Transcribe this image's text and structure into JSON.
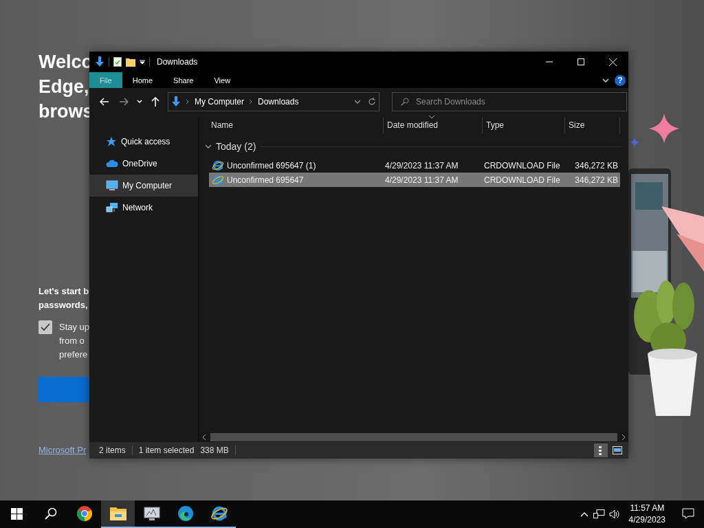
{
  "background_page": {
    "heading_lines": [
      "Welco",
      "Edge,",
      "brows"
    ],
    "intro_lines": [
      "Let's start b",
      "passwords,"
    ],
    "checkbox": {
      "checked": true,
      "lines": [
        "Stay up",
        "from o",
        "prefere"
      ]
    },
    "link": "Microsoft Pr"
  },
  "window": {
    "title": "Downloads",
    "ribbon_tabs": [
      {
        "label": "File",
        "selected": true
      },
      {
        "label": "Home",
        "selected": false
      },
      {
        "label": "Share",
        "selected": false
      },
      {
        "label": "View",
        "selected": false
      }
    ],
    "help": "?",
    "address": {
      "path": [
        "My Computer",
        "Downloads"
      ]
    },
    "search": {
      "placeholder": "Search Downloads"
    },
    "nav_pane": [
      {
        "label": "Quick access",
        "kind": "star",
        "selected": false
      },
      {
        "label": "OneDrive",
        "kind": "cloud",
        "selected": false
      },
      {
        "label": "My Computer",
        "kind": "computer",
        "selected": true
      },
      {
        "label": "Network",
        "kind": "network",
        "selected": false
      }
    ],
    "columns": [
      "Name",
      "Date modified",
      "Type",
      "Size"
    ],
    "groups": [
      {
        "label": "Today (2)",
        "expanded": true,
        "rows": [
          {
            "name": "Unconfirmed 695647 (1)",
            "date": "4/29/2023 11:37 AM",
            "type": "CRDOWNLOAD File",
            "size": "346,272 KB",
            "selected": false
          },
          {
            "name": "Unconfirmed 695647",
            "date": "4/29/2023 11:37 AM",
            "type": "CRDOWNLOAD File",
            "size": "346,272 KB",
            "selected": true
          }
        ]
      }
    ],
    "status_bar": {
      "item_count": "2 items",
      "selection": "1 item selected",
      "selection_size": "338 MB"
    },
    "views": [
      {
        "kind": "details",
        "selected": true
      },
      {
        "kind": "large-icons",
        "selected": false
      }
    ]
  },
  "taskbar": {
    "apps": [
      {
        "kind": "chrome",
        "running": false,
        "selected": false
      },
      {
        "kind": "folder",
        "running": true,
        "selected": true
      },
      {
        "kind": "monitor",
        "running": true,
        "selected": false
      },
      {
        "kind": "edge",
        "running": true,
        "selected": false
      },
      {
        "kind": "ie",
        "running": true,
        "selected": false
      }
    ],
    "time": "11:57 AM",
    "date": "4/29/2023"
  }
}
